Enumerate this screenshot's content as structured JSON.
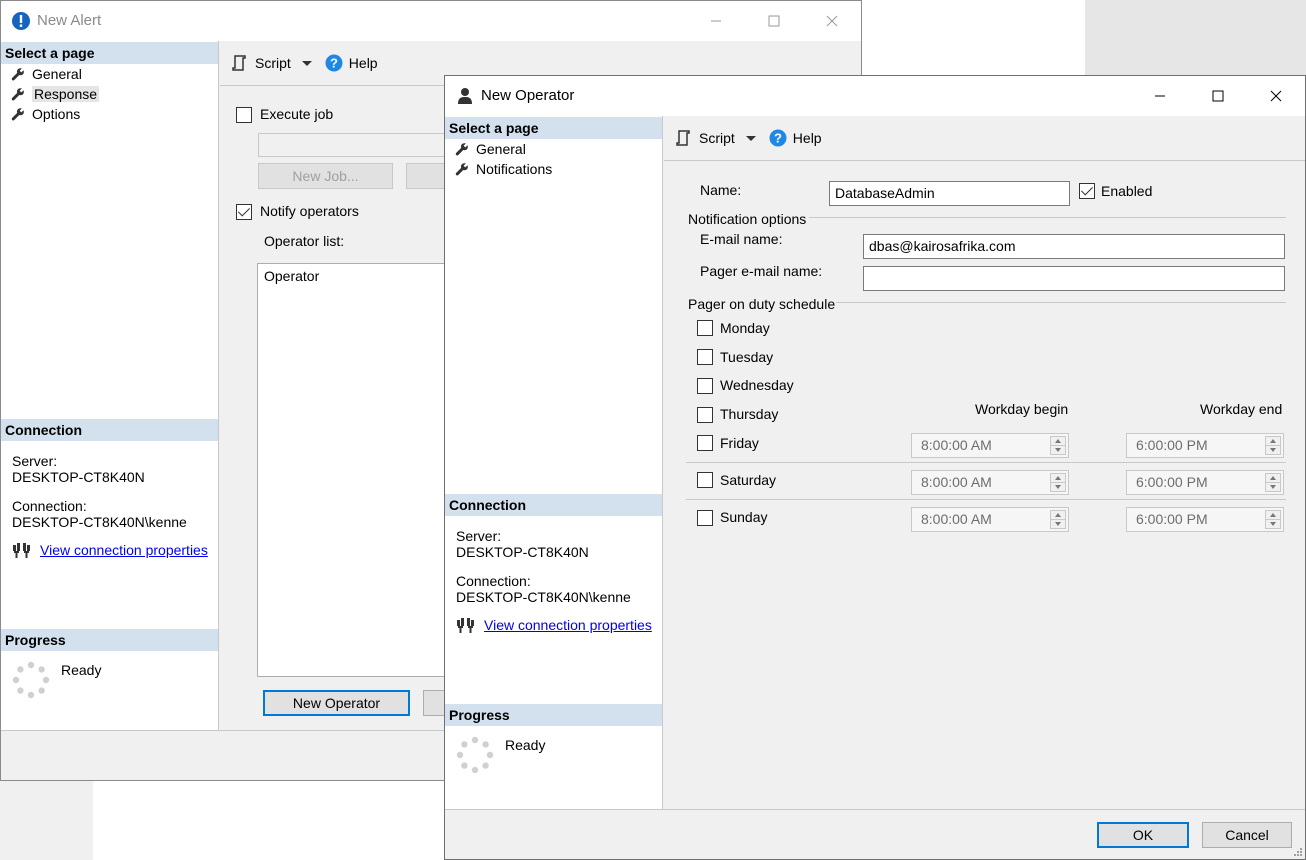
{
  "alert_window": {
    "title": "New Alert",
    "select_page_header": "Select a page",
    "pages": [
      "General",
      "Response",
      "Options"
    ],
    "selected_page": "Response",
    "toolbar": {
      "script_label": "Script",
      "help_label": "Help"
    },
    "execute_job_label": "Execute job",
    "new_job_button": "New Job...",
    "notify_operators_label": "Notify operators",
    "operator_list_label": "Operator list:",
    "operator_column_header": "Operator",
    "new_operator_button": "New Operator",
    "connection": {
      "header": "Connection",
      "server_label": "Server:",
      "server_value": "DESKTOP-CT8K40N",
      "connection_label": "Connection:",
      "connection_value": "DESKTOP-CT8K40N\\kenne",
      "view_properties_link": "View connection properties"
    },
    "progress": {
      "header": "Progress",
      "status": "Ready"
    }
  },
  "operator_window": {
    "title": "New Operator",
    "select_page_header": "Select a page",
    "pages": [
      "General",
      "Notifications"
    ],
    "toolbar": {
      "script_label": "Script",
      "help_label": "Help"
    },
    "name_label": "Name:",
    "name_value": "DatabaseAdmin",
    "enabled_label": "Enabled",
    "notification_options_label": "Notification options",
    "email_name_label": "E-mail name:",
    "email_name_value": "dbas@kairosafrika.com",
    "pager_email_label": "Pager e-mail name:",
    "pager_email_value": "",
    "pager_schedule_label": "Pager on duty schedule",
    "workday_begin_label": "Workday begin",
    "workday_end_label": "Workday end",
    "days": [
      "Monday",
      "Tuesday",
      "Wednesday",
      "Thursday",
      "Friday",
      "Saturday",
      "Sunday"
    ],
    "schedule": {
      "friday": {
        "begin": "8:00:00 AM",
        "end": "6:00:00 PM"
      },
      "saturday": {
        "begin": "8:00:00 AM",
        "end": "6:00:00 PM"
      },
      "sunday": {
        "begin": "8:00:00 AM",
        "end": "6:00:00 PM"
      }
    },
    "connection": {
      "header": "Connection",
      "server_label": "Server:",
      "server_value": "DESKTOP-CT8K40N",
      "connection_label": "Connection:",
      "connection_value": "DESKTOP-CT8K40N\\kenne",
      "view_properties_link": "View connection properties"
    },
    "progress": {
      "header": "Progress",
      "status": "Ready"
    },
    "ok_button": "OK",
    "cancel_button": "Cancel"
  },
  "colors": {
    "header_band": "#d3e1ee",
    "accent": "#0078d7",
    "link": "#0000ee",
    "help_icon": "#1e88e5",
    "alert_icon": "#1565c0"
  }
}
